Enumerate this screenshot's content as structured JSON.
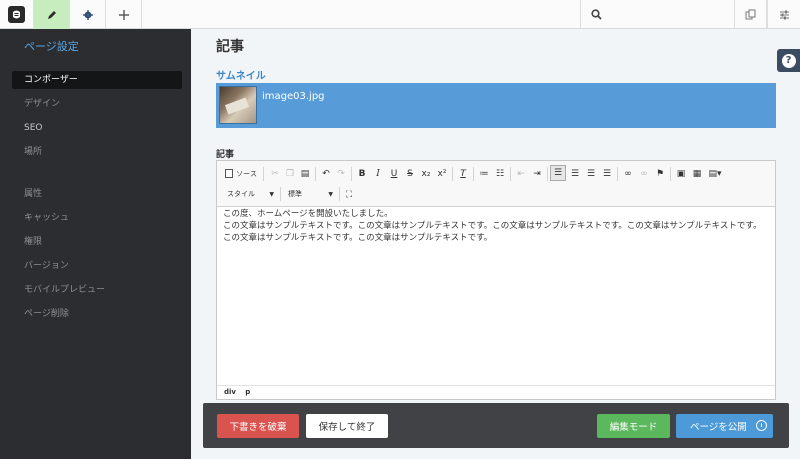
{
  "topbar": {
    "search_placeholder": "",
    "icons": [
      "logo-icon",
      "pencil-icon",
      "gear-icon",
      "plus-icon",
      "search-icon",
      "copy-icon",
      "sliders-icon"
    ]
  },
  "sidebar": {
    "title": "ページ設定",
    "items": [
      {
        "label": "コンポーザー",
        "active": true
      },
      {
        "label": "デザイン"
      },
      {
        "label": "SEO"
      },
      {
        "label": "場所"
      },
      {
        "label": "属性"
      },
      {
        "label": "キャッシュ"
      },
      {
        "label": "権限"
      },
      {
        "label": "バージョン"
      },
      {
        "label": "モバイルプレビュー"
      },
      {
        "label": "ページ削除"
      }
    ]
  },
  "main": {
    "title": "記事",
    "thumbnail_label": "サムネイル",
    "thumbnail_filename": "image03.jpg",
    "article_label": "記事"
  },
  "editor": {
    "source_label": "ソース",
    "style_combo": "スタイル",
    "format_combo": "標準",
    "content_lines": [
      "この度、ホームページを開設いたしました。",
      "この文章はサンプルテキストです。この文章はサンプルテキストです。この文章はサンプルテキストです。この文章はサンプルテキストです。",
      "この文章はサンプルテキストです。この文章はサンプルテキストです。"
    ],
    "status_path": [
      "div",
      "p"
    ]
  },
  "footer": {
    "discard_label": "下書きを破棄",
    "save_label": "保存して終了",
    "editmode_label": "編集モード",
    "publish_label": "ページを公開"
  },
  "help_label": "?",
  "colors": {
    "sidebar_bg": "#2c2d30",
    "accent_blue": "#4c9bd8",
    "thumb_bg": "#579bd8",
    "discard_red": "#d9534f",
    "editmode_green": "#5cb85c",
    "edit_tab_green": "#c7ecbd"
  }
}
